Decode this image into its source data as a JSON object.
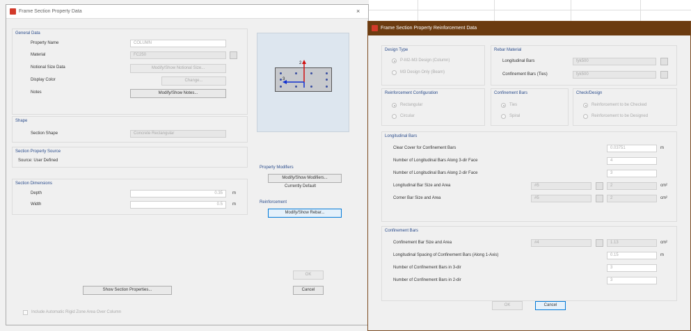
{
  "background": {
    "bg_color": "#f1f1f1"
  },
  "main_dialog": {
    "title": "Frame Section Property Data",
    "close_label": "×",
    "general_data": {
      "title": "General Data",
      "property_name_label": "Property Name",
      "property_name_value": "COLUMN",
      "material_label": "Material",
      "material_value": "FC250",
      "notional_size_label": "Notional Size Data",
      "notional_size_button": "Modify/Show Notional Size...",
      "display_color_label": "Display Color",
      "display_color_button": "Change...",
      "notes_label": "Notes",
      "notes_button": "Modify/Show Notes..."
    },
    "shape": {
      "title": "Shape",
      "section_shape_label": "Section Shape",
      "section_shape_value": "Concrete Rectangular"
    },
    "section_property_source": {
      "title": "Section Property Source",
      "source_text": "Source: User Defined"
    },
    "section_dimensions": {
      "title": "Section Dimensions",
      "depth_label": "Depth",
      "depth_value": "0.35",
      "depth_unit": "m",
      "width_label": "Width",
      "width_value": "0.5",
      "width_unit": "m"
    },
    "property_modifiers": {
      "title": "Property Modifiers",
      "button": "Modify/Show Modifiers...",
      "status": "Currently Default"
    },
    "reinforcement": {
      "title": "Reinforcement",
      "button": "Modify/Show Rebar..."
    },
    "show_section_properties_button": "Show Section Properties...",
    "ok_button": "OK",
    "cancel_button": "Cancel",
    "bottom_checkbox_label": "Include Automatic Rigid Zone Area Over Column"
  },
  "reinforcement_dialog": {
    "title": "Frame Section Property Reinforcement Data",
    "design_type": {
      "title": "Design Type",
      "option1": "P-M2-M3 Design (Column)",
      "option2": "M3 Design Only (Beam)"
    },
    "rebar_material": {
      "title": "Rebar Material",
      "longitudinal_label": "Longitudinal Bars",
      "longitudinal_value": "fyk500",
      "confinement_label": "Confinement Bars (Ties)",
      "confinement_value": "fyk500"
    },
    "reinforcement_configuration": {
      "title": "Reinforcement Configuration",
      "option1": "Rectangular",
      "option2": "Circular"
    },
    "confinement_bars_group": {
      "title": "Confinement Bars",
      "option1": "Ties",
      "option2": "Spiral"
    },
    "check_design": {
      "title": "Check/Design",
      "option1": "Reinforcement to be Checked",
      "option2": "Reinforcement to be Designed"
    },
    "longitudinal_bars": {
      "title": "Longitudinal Bars",
      "clear_cover_label": "Clear Cover for Confinement Bars",
      "clear_cover_value": "0.03751",
      "clear_cover_unit": "m",
      "num_3dir_label": "Number of Longitudinal Bars Along 3-dir Face",
      "num_3dir_value": "4",
      "num_2dir_label": "Number of Longitudinal Bars Along 2-dir Face",
      "num_2dir_value": "3",
      "bar_size_label": "Longitudinal Bar Size and Area",
      "bar_size_value": "#5",
      "bar_area_value": "2",
      "bar_area_unit": "cm²",
      "corner_bar_label": "Corner Bar Size and Area",
      "corner_bar_value": "#5",
      "corner_area_value": "2",
      "corner_area_unit": "cm²"
    },
    "confinement_bars": {
      "title": "Confinement Bars",
      "bar_size_label": "Confinement Bar Size and Area",
      "bar_size_value": "#4",
      "bar_area_value": "1.13",
      "bar_area_unit": "cm²",
      "spacing_label": "Longitudinal Spacing of Confinement Bars (Along 1-Axis)",
      "spacing_value": "0.15",
      "spacing_unit": "m",
      "num_3dir_label": "Number of Confinement Bars in 3-dir",
      "num_3dir_value": "3",
      "num_2dir_label": "Number of Confinement Bars in 2-dir",
      "num_2dir_value": "3"
    },
    "ok_button": "OK",
    "cancel_button": "Cancel"
  }
}
